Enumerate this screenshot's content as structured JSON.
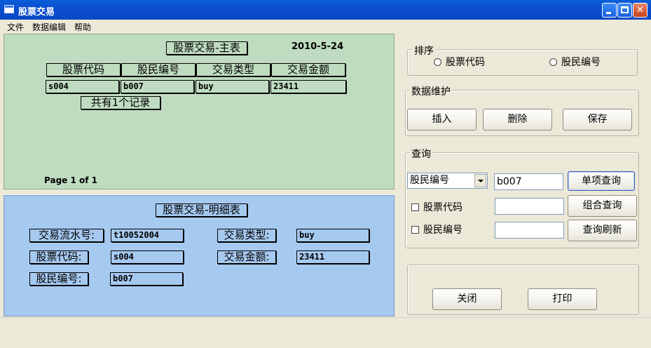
{
  "window": {
    "title": "股票交易"
  },
  "menu": [
    "文件",
    "数据编辑",
    "帮助"
  ],
  "main_report": {
    "title": "股票交易-主表",
    "date": "2010-5-24",
    "columns": [
      "股票代码",
      "股民编号",
      "交易类型",
      "交易金额"
    ],
    "row": [
      "s004",
      "b007",
      "buy",
      "23411"
    ],
    "record_count": "共有1个记录",
    "page_text": "Page 1 of 1"
  },
  "detail": {
    "title": "股票交易-明细表",
    "labels": {
      "serial": "交易流水号:",
      "stock_code": "股票代码:",
      "investor_no": "股民编号:",
      "type": "交易类型:",
      "amount": "交易金额:"
    },
    "values": {
      "serial": "t10052004",
      "stock_code": "s004",
      "investor_no": "b007",
      "type": "buy",
      "amount": "23411"
    }
  },
  "sort": {
    "title": "排序",
    "options": [
      "股票代码",
      "股民编号"
    ]
  },
  "maintenance": {
    "title": "数据维护",
    "insert": "插入",
    "delete": "删除",
    "save": "保存"
  },
  "query": {
    "title": "查询",
    "field_selected": "股民编号",
    "single_value": "b007",
    "single_button": "单项查询",
    "check_stock_code": "股票代码",
    "check_investor_no": "股民编号",
    "stock_code_value": "",
    "investor_no_value": "",
    "combined_button": "组合查询",
    "refresh_button": "查询刷新"
  },
  "footer": {
    "close": "关闭",
    "print": "打印"
  }
}
